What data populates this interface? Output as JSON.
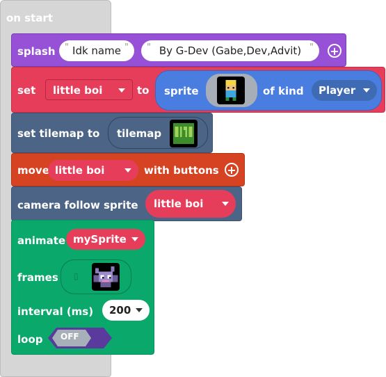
{
  "on_start": {
    "label": "on start"
  },
  "splash": {
    "keyword": "splash",
    "title": "Idk name",
    "subtitle": "By G-Dev (Gabe,Dev,Advit)",
    "quote": "\"",
    "add_icon": "plus-circle-icon"
  },
  "set_sprite": {
    "keyword": "set",
    "variable": "little boi",
    "to_label": "to",
    "sprite_label": "sprite",
    "of_kind_label": "of kind",
    "kind": "Player"
  },
  "set_tilemap": {
    "keyword": "set tilemap to",
    "tilemap_label": "tilemap"
  },
  "move": {
    "keyword": "move",
    "variable": "little boi",
    "with_buttons_label": "with buttons"
  },
  "camera": {
    "keyword": "camera follow sprite",
    "variable": "little boi"
  },
  "animate": {
    "keyword": "animate",
    "variable": "mySprite",
    "frames_label": "frames",
    "interval_label": "interval (ms)",
    "interval_value": "200",
    "loop_label": "loop",
    "loop_toggle": "OFF"
  },
  "colors": {
    "event": "#d6d6d6",
    "looks": "#9651d6",
    "sprites": "#e63e5a",
    "scene": "#4c6587",
    "controller": "#d54322",
    "animation": "#0aa86a",
    "kind_dropdown": "#3f6ab4",
    "sprite_block": "#4a7de0"
  }
}
